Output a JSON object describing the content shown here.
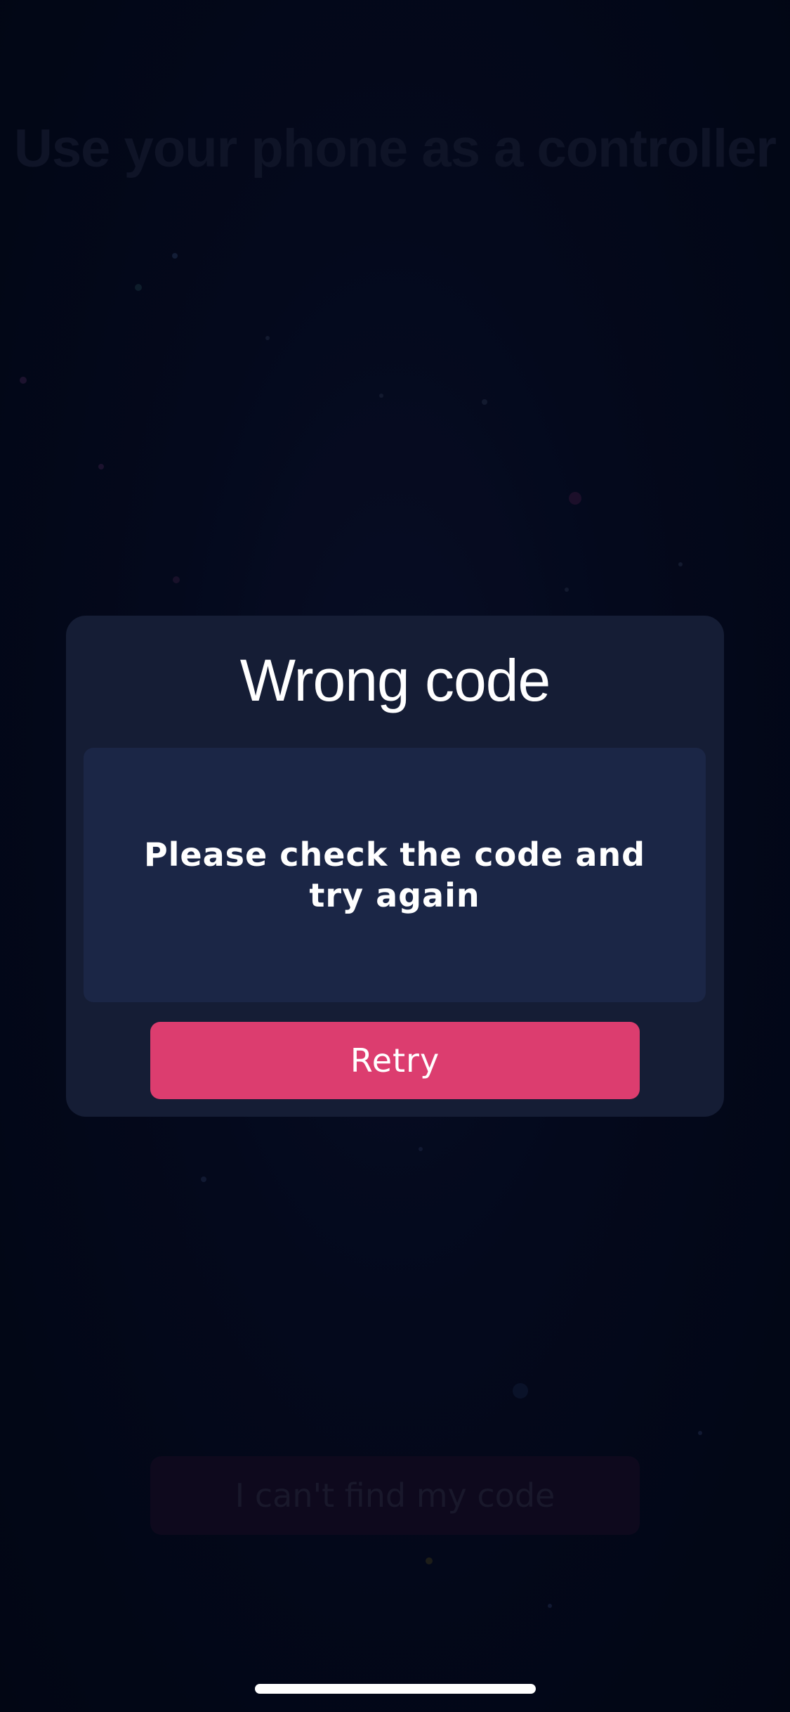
{
  "background": {
    "title": "Use your phone as a controller",
    "cant_find_code_label": "I can't find my code"
  },
  "modal": {
    "title": "Wrong code",
    "message": "Please check the code and try again",
    "retry_label": "Retry"
  },
  "colors": {
    "accent": "#dc3d6f",
    "modal_bg": "#151d35",
    "message_bg": "#1b2646",
    "page_bg": "#030a1d"
  }
}
